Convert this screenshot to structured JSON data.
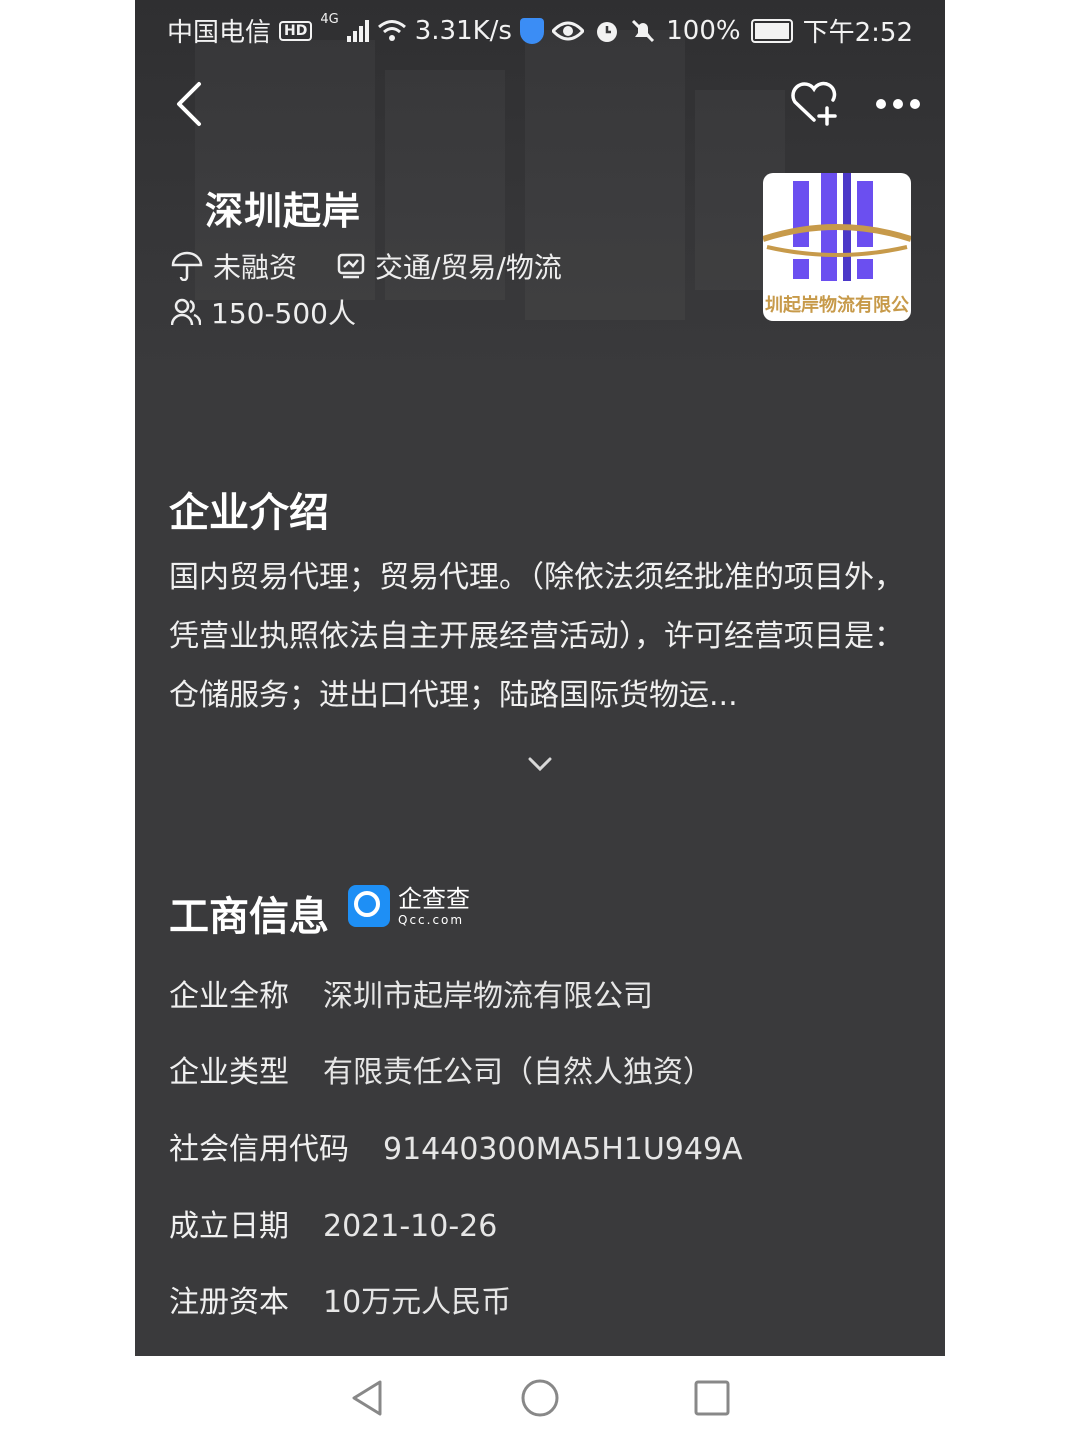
{
  "status_bar": {
    "carrier": "中国电信",
    "hd": "HD",
    "network": "4G",
    "speed": "3.31K/s",
    "battery": "100%",
    "time": "下午2:52"
  },
  "company": {
    "name": "深圳起岸",
    "funding": "未融资",
    "industry": "交通/贸易/物流",
    "size": "150-500人",
    "logo_text": "圳起岸物流有限公"
  },
  "intro": {
    "title": "企业介绍",
    "text": "国内贸易代理；贸易代理。（除依法须经批准的项目外，凭营业执照依法自主开展经营活动），许可经营项目是：仓储服务；进出口代理；陆路国际货物运..."
  },
  "business_info": {
    "title": "工商信息",
    "source_cn": "企查查",
    "source_en": "Qcc.com",
    "rows": [
      {
        "label": "企业全称",
        "value": "深圳市起岸物流有限公司"
      },
      {
        "label": "企业类型",
        "value": "有限责任公司（自然人独资）"
      },
      {
        "label": "社会信用代码",
        "value": "91440300MA5H1U949A"
      },
      {
        "label": "成立日期",
        "value": "2021-10-26"
      },
      {
        "label": "注册资本",
        "value": "10万元人民币"
      }
    ]
  },
  "colors": {
    "background": "#3a3a3c",
    "accent_blue": "#1e8ff5",
    "logo_purple": "#6b4ff0",
    "logo_gold": "#c79a4a"
  }
}
